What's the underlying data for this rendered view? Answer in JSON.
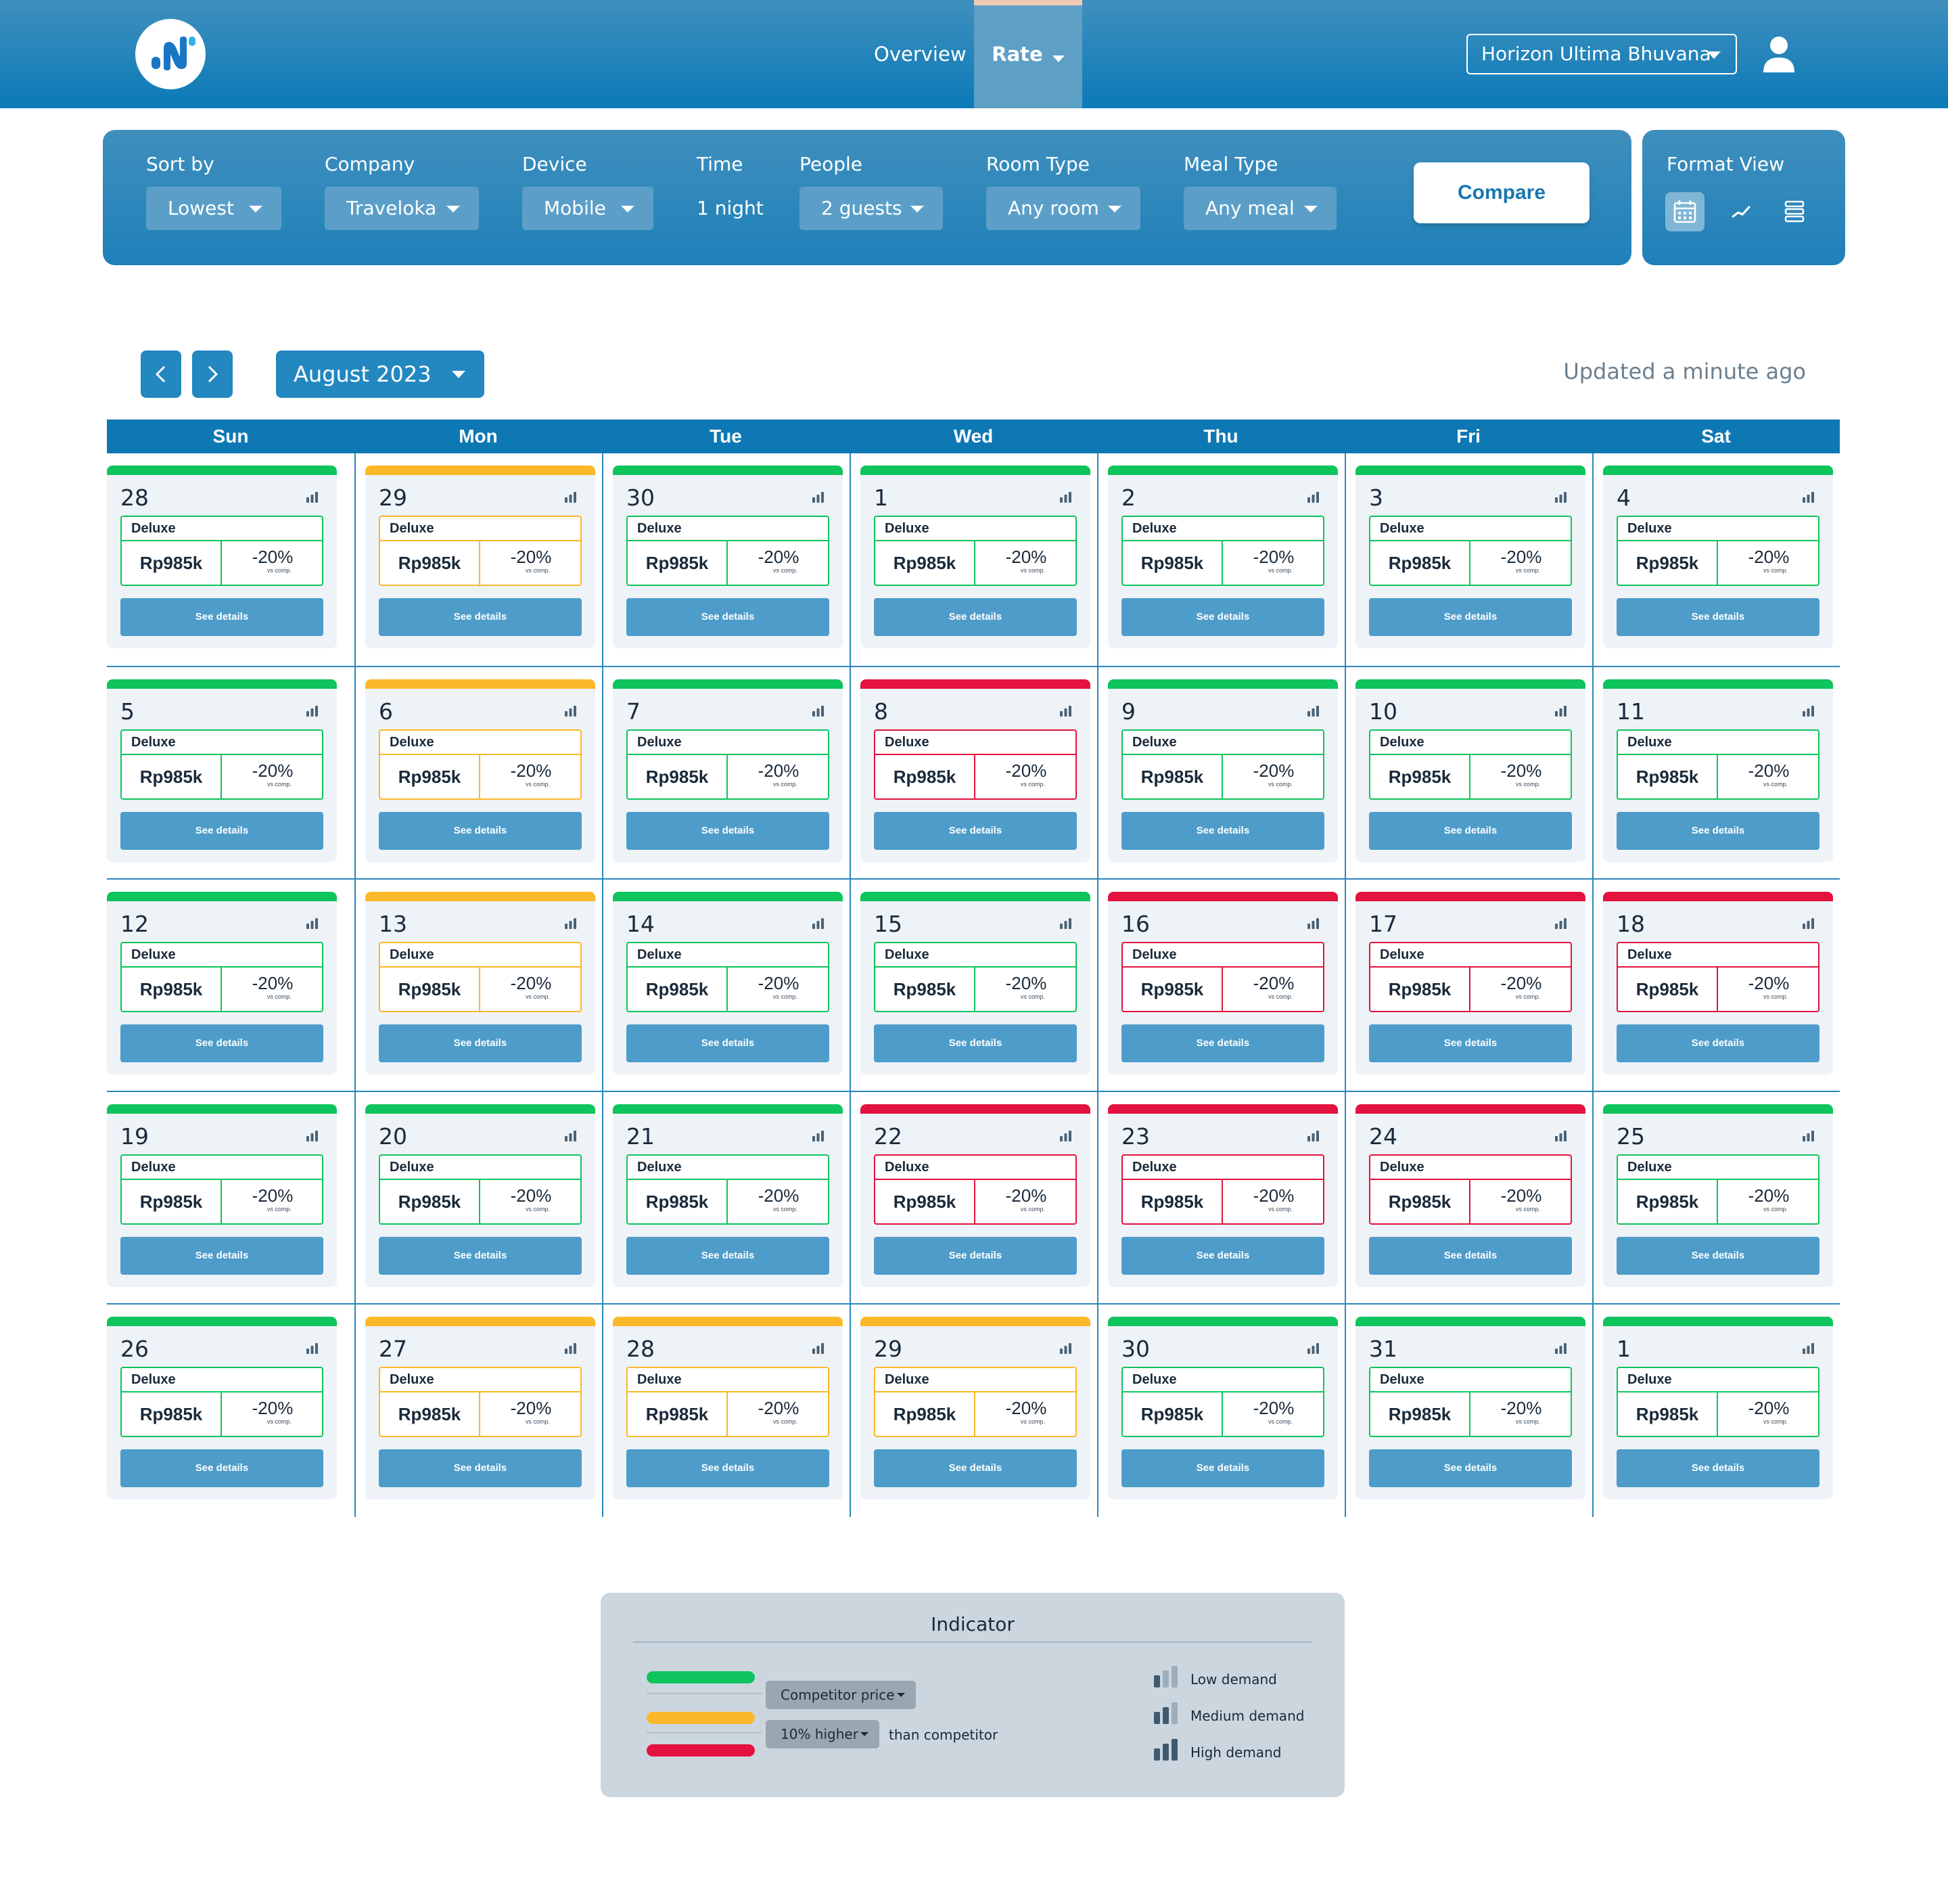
{
  "header": {
    "nav": {
      "overview": "Overview",
      "rate": "Rate"
    },
    "hotel": "Horizon Ultima Bhuvana"
  },
  "icons": {
    "logo": "app-logo",
    "user": "user-icon",
    "calendar_view": "calendar-icon",
    "line_view": "line-chart-icon",
    "list_view": "list-icon",
    "prev": "chevron-left-icon",
    "next": "chevron-right-icon",
    "demand": "signal-bars-icon"
  },
  "filters": {
    "sort_by": {
      "label": "Sort by",
      "value": "Lowest"
    },
    "company": {
      "label": "Company",
      "value": "Traveloka"
    },
    "device": {
      "label": "Device",
      "value": "Mobile"
    },
    "time": {
      "label": "Time",
      "value": "1 night"
    },
    "people": {
      "label": "People",
      "value": "2 guests"
    },
    "room_type": {
      "label": "Room Type",
      "value": "Any room"
    },
    "meal_type": {
      "label": "Meal Type",
      "value": "Any meal"
    },
    "compare": "Compare",
    "format_view": "Format View"
  },
  "calendar": {
    "month": "August 2023",
    "updated": "Updated a minute ago",
    "weekdays": [
      "Sun",
      "Mon",
      "Tue",
      "Wed",
      "Thu",
      "Fri",
      "Sat"
    ],
    "colors": {
      "green": "#0ec45c",
      "yellow": "#fbb829",
      "red": "#e3123e"
    },
    "days": [
      {
        "day": "28",
        "level": "green"
      },
      {
        "day": "29",
        "level": "yellow"
      },
      {
        "day": "30",
        "level": "green"
      },
      {
        "day": "1",
        "level": "green"
      },
      {
        "day": "2",
        "level": "green"
      },
      {
        "day": "3",
        "level": "green"
      },
      {
        "day": "4",
        "level": "green"
      },
      {
        "day": "5",
        "level": "green"
      },
      {
        "day": "6",
        "level": "yellow"
      },
      {
        "day": "7",
        "level": "green"
      },
      {
        "day": "8",
        "level": "red"
      },
      {
        "day": "9",
        "level": "green"
      },
      {
        "day": "10",
        "level": "green"
      },
      {
        "day": "11",
        "level": "green"
      },
      {
        "day": "12",
        "level": "green"
      },
      {
        "day": "13",
        "level": "yellow"
      },
      {
        "day": "14",
        "level": "green"
      },
      {
        "day": "15",
        "level": "green"
      },
      {
        "day": "16",
        "level": "red"
      },
      {
        "day": "17",
        "level": "red"
      },
      {
        "day": "18",
        "level": "red"
      },
      {
        "day": "19",
        "level": "green"
      },
      {
        "day": "20",
        "level": "green"
      },
      {
        "day": "21",
        "level": "green"
      },
      {
        "day": "22",
        "level": "red"
      },
      {
        "day": "23",
        "level": "red"
      },
      {
        "day": "24",
        "level": "red"
      },
      {
        "day": "25",
        "level": "green"
      },
      {
        "day": "26",
        "level": "green"
      },
      {
        "day": "27",
        "level": "yellow"
      },
      {
        "day": "28",
        "level": "yellow"
      },
      {
        "day": "29",
        "level": "yellow"
      },
      {
        "day": "30",
        "level": "green"
      },
      {
        "day": "31",
        "level": "green"
      },
      {
        "day": "1",
        "level": "green"
      }
    ],
    "card": {
      "room": "Deluxe",
      "price": "Rp985k",
      "diff": "-20%",
      "vs": "vs comp.",
      "button": "See details"
    }
  },
  "indicator": {
    "title": "Indicator",
    "competitor_select": "Competitor price",
    "higher_select": "10% higher",
    "than": "than competitor",
    "low": "Low demand",
    "medium": "Medium demand",
    "high": "High demand"
  }
}
